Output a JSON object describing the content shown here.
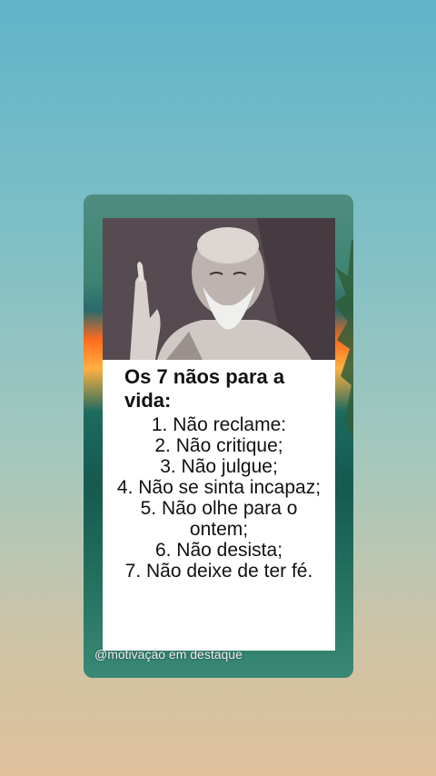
{
  "post": {
    "title": "Os 7 nãos para a vida:",
    "rules": [
      "1. Não reclame:",
      "2. Não critique;",
      "3. Não julgue;",
      "4. Não se sinta incapaz;",
      "5. Não olhe para o ontem;",
      "6. Não desista;",
      "7. Não deixe de ter fé."
    ]
  },
  "watermark": "@motivação em destaque",
  "colors": {
    "background_top": "#5fb4c8",
    "background_bottom": "#e0c29c",
    "card_panel": "#ffffff",
    "text": "#111111",
    "sunset_accent": "#ff6a1e"
  },
  "icons": {
    "portrait": "elderly-bearded-man-photo",
    "palm": "palm-leaf"
  }
}
